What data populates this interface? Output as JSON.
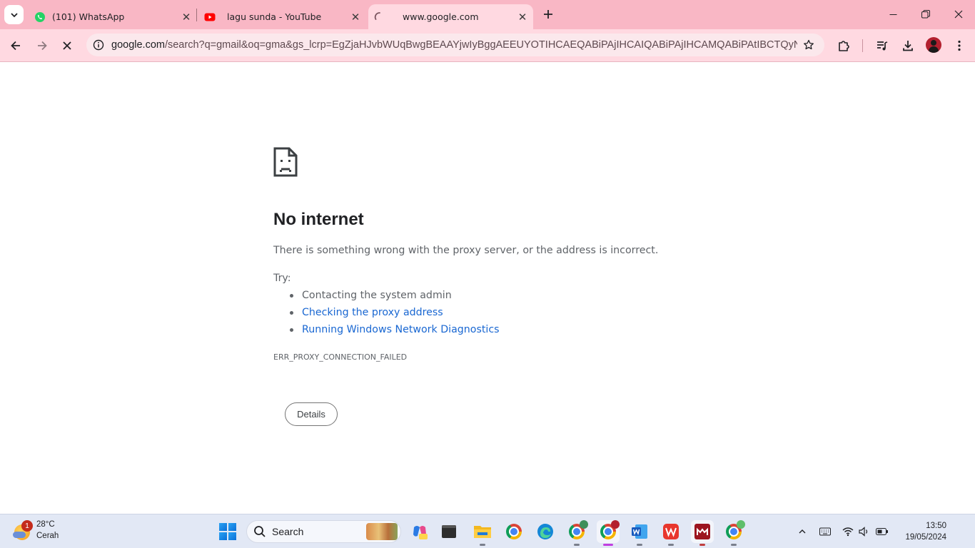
{
  "browser": {
    "tabs": [
      {
        "title": "(101) WhatsApp",
        "favicon": "whatsapp-icon"
      },
      {
        "title": "lagu sunda - YouTube",
        "favicon": "youtube-icon"
      },
      {
        "title": "www.google.com",
        "favicon": "loading-spinner-icon",
        "active": true
      }
    ],
    "address": {
      "url_host": "google.com",
      "url_rest": "/search?q=gmail&oq=gma&gs_lcrp=EgZjaHJvbWUqBwgBEAAYjwIyBggAEEUYOTIHCAEQABiPAjIHCAIQABiPAjIHCAMQABiPAtIBCTQyNDJqMGo..."
    },
    "colors": {
      "tab_strip": "#f9b7c5",
      "toolbar": "#ffd9e1"
    }
  },
  "error_page": {
    "title": "No internet",
    "summary": "There is something wrong with the proxy server, or the address is incorrect.",
    "try_label": "Try:",
    "suggestions": [
      "Contacting the system admin",
      "Checking the proxy address",
      "Running Windows Network Diagnostics"
    ],
    "error_code": "ERR_PROXY_CONNECTION_FAILED",
    "details_button": "Details"
  },
  "taskbar": {
    "weather": {
      "temp": "28°C",
      "condition": "Cerah",
      "badge": "1"
    },
    "search_label": "Search",
    "clock": {
      "time": "13:50",
      "date": "19/05/2024"
    }
  }
}
